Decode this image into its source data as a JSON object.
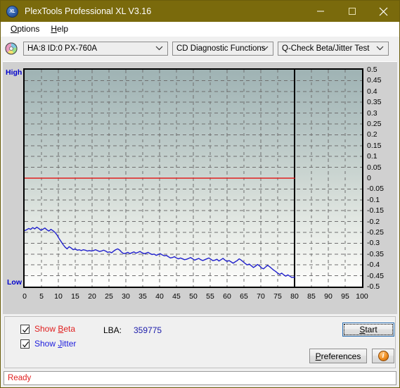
{
  "window": {
    "title": "PlexTools Professional XL V3.16",
    "app_icon": "xl-disc-icon",
    "minimize": "minimize-button",
    "maximize": "maximize-button",
    "close": "close-button"
  },
  "menubar": {
    "items": [
      {
        "label": "Options",
        "mnemonic": "O"
      },
      {
        "label": "Help",
        "mnemonic": "H"
      }
    ]
  },
  "toolbar": {
    "drive_icon": "cd-disc-icon",
    "drive_select": "HA:8 ID:0  PX-760A",
    "function_select": "CD Diagnostic Functions",
    "test_select": "Q-Check Beta/Jitter Test"
  },
  "controls": {
    "show_beta_label": "Show Beta",
    "show_beta_mnemonic": "B",
    "show_beta_checked": true,
    "show_jitter_label": "Show Jitter",
    "show_jitter_mnemonic": "J",
    "show_jitter_checked": true,
    "lba_label": "LBA:",
    "lba_value": "359775",
    "start_label": "Start",
    "start_mnemonic": "S",
    "preferences_label": "Preferences",
    "preferences_mnemonic": "P",
    "info_label": "i"
  },
  "statusbar": {
    "text": "Ready"
  },
  "colors": {
    "titlebar": "#7a6a0c",
    "beta_line": "#e02020",
    "jitter_line": "#2020cc",
    "axis_label": "#0000cc",
    "status_text": "#e02020"
  },
  "chart_data": {
    "type": "line",
    "title": "",
    "xlabel": "",
    "ylabel": "",
    "xlim": [
      0,
      100
    ],
    "ylim": [
      -0.5,
      0.5
    ],
    "grid": true,
    "legend": "none",
    "y_left_top_label": "High",
    "y_left_bottom_label": "Low",
    "x_ticks": [
      0,
      5,
      10,
      15,
      20,
      25,
      30,
      35,
      40,
      45,
      50,
      55,
      60,
      65,
      70,
      75,
      80,
      85,
      90,
      95,
      100
    ],
    "y_ticks": [
      0.5,
      0.45,
      0.4,
      0.35,
      0.3,
      0.25,
      0.2,
      0.15,
      0.1,
      0.05,
      0,
      -0.05,
      -0.1,
      -0.15,
      -0.2,
      -0.25,
      -0.3,
      -0.35,
      -0.4,
      -0.45,
      -0.5
    ],
    "y_tick_labels": [
      "0.5",
      "0.45",
      "0.4",
      "0.35",
      "0.3",
      "0.25",
      "0.2",
      "0.15",
      "0.1",
      "0.05",
      "0",
      "-0.05",
      "-0.1",
      "-0.15",
      "-0.2",
      "-0.25",
      "-0.3",
      "-0.35",
      "-0.4",
      "-0.45",
      "-0.5"
    ],
    "data_end_x": 80,
    "series": [
      {
        "name": "Beta",
        "color": "#e02020",
        "x": [
          0,
          10,
          20,
          30,
          40,
          50,
          60,
          70,
          80
        ],
        "values": [
          0,
          0,
          0,
          0,
          0,
          0,
          0,
          0,
          0
        ]
      },
      {
        "name": "Jitter",
        "color": "#2020cc",
        "x": [
          0,
          0.6,
          1.2,
          1.8,
          2.4,
          3.0,
          3.6,
          4.2,
          4.8,
          5.4,
          6.0,
          6.6,
          7.2,
          7.8,
          8.4,
          9.0,
          9.6,
          10.2,
          10.8,
          11.4,
          12.0,
          12.6,
          13.2,
          13.8,
          14.4,
          15.0,
          15.6,
          16.2,
          16.8,
          17.4,
          18.0,
          18.6,
          19.2,
          19.8,
          20.4,
          21.0,
          21.6,
          22.2,
          22.8,
          23.4,
          24.0,
          24.6,
          25.2,
          25.8,
          26.4,
          27.0,
          27.6,
          28.2,
          28.8,
          29.4,
          30.0,
          30.6,
          31.2,
          31.8,
          32.4,
          33.0,
          33.6,
          34.2,
          34.8,
          35.4,
          36.0,
          36.6,
          37.2,
          37.8,
          38.4,
          39.0,
          39.6,
          40.2,
          40.8,
          41.4,
          42.0,
          42.6,
          43.2,
          43.8,
          44.4,
          45.0,
          45.6,
          46.2,
          46.8,
          47.4,
          48.0,
          48.6,
          49.2,
          49.8,
          50.4,
          51.0,
          51.6,
          52.2,
          52.8,
          53.4,
          54.0,
          54.6,
          55.2,
          55.8,
          56.4,
          57.0,
          57.6,
          58.2,
          58.8,
          59.4,
          60.0,
          60.6,
          61.2,
          61.8,
          62.4,
          63.0,
          63.6,
          64.2,
          64.8,
          65.4,
          66.0,
          66.6,
          67.2,
          67.8,
          68.4,
          69.0,
          69.6,
          70.2,
          70.8,
          71.4,
          72.0,
          72.6,
          73.2,
          73.8,
          74.4,
          75.0,
          75.6,
          76.2,
          76.8,
          77.4,
          78.0,
          78.6,
          79.2,
          80.0
        ],
        "values": [
          -0.242,
          -0.238,
          -0.232,
          -0.236,
          -0.228,
          -0.234,
          -0.226,
          -0.232,
          -0.24,
          -0.236,
          -0.23,
          -0.238,
          -0.244,
          -0.236,
          -0.242,
          -0.25,
          -0.262,
          -0.278,
          -0.292,
          -0.306,
          -0.318,
          -0.326,
          -0.316,
          -0.322,
          -0.33,
          -0.326,
          -0.332,
          -0.33,
          -0.334,
          -0.33,
          -0.332,
          -0.336,
          -0.334,
          -0.336,
          -0.334,
          -0.33,
          -0.334,
          -0.338,
          -0.336,
          -0.332,
          -0.336,
          -0.342,
          -0.34,
          -0.344,
          -0.336,
          -0.33,
          -0.326,
          -0.332,
          -0.342,
          -0.348,
          -0.346,
          -0.342,
          -0.348,
          -0.344,
          -0.34,
          -0.346,
          -0.342,
          -0.338,
          -0.344,
          -0.348,
          -0.346,
          -0.342,
          -0.348,
          -0.352,
          -0.35,
          -0.356,
          -0.352,
          -0.348,
          -0.354,
          -0.358,
          -0.356,
          -0.362,
          -0.368,
          -0.366,
          -0.362,
          -0.368,
          -0.372,
          -0.368,
          -0.372,
          -0.376,
          -0.374,
          -0.37,
          -0.366,
          -0.372,
          -0.378,
          -0.374,
          -0.37,
          -0.376,
          -0.38,
          -0.376,
          -0.372,
          -0.368,
          -0.374,
          -0.38,
          -0.378,
          -0.374,
          -0.382,
          -0.376,
          -0.37,
          -0.378,
          -0.384,
          -0.38,
          -0.386,
          -0.392,
          -0.386,
          -0.38,
          -0.372,
          -0.378,
          -0.386,
          -0.394,
          -0.4,
          -0.396,
          -0.404,
          -0.412,
          -0.406,
          -0.398,
          -0.404,
          -0.414,
          -0.418,
          -0.41,
          -0.402,
          -0.408,
          -0.416,
          -0.424,
          -0.43,
          -0.438,
          -0.444,
          -0.438,
          -0.446,
          -0.452,
          -0.446,
          -0.452,
          -0.458,
          -0.456,
          -0.458
        ]
      }
    ]
  }
}
